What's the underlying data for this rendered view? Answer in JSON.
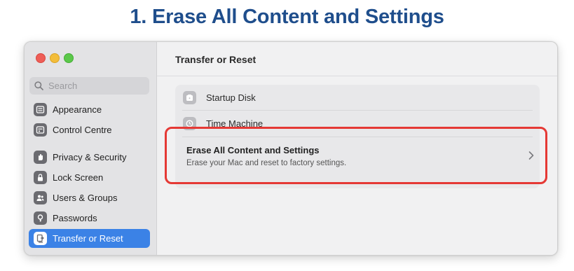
{
  "heading": "1. Erase All Content and Settings",
  "window": {
    "traffic_lights": [
      "close",
      "minimize",
      "zoom"
    ]
  },
  "sidebar": {
    "search_placeholder": "Search",
    "items": [
      {
        "label": "Appearance",
        "icon": "appearance-icon"
      },
      {
        "label": "Control Centre",
        "icon": "control-centre-icon"
      },
      {
        "label": "Privacy & Security",
        "icon": "hand-icon"
      },
      {
        "label": "Lock Screen",
        "icon": "lock-icon"
      },
      {
        "label": "Users & Groups",
        "icon": "users-icon"
      },
      {
        "label": "Passwords",
        "icon": "key-icon"
      },
      {
        "label": "Transfer or Reset",
        "icon": "transfer-reset-icon",
        "active": true
      }
    ]
  },
  "main": {
    "title": "Transfer or Reset",
    "rows": [
      {
        "label": "Startup Disk",
        "icon": "disk-icon"
      },
      {
        "label": "Time Machine",
        "icon": "time-machine-icon"
      }
    ],
    "erase": {
      "title": "Erase All Content and Settings",
      "subtitle": "Erase your Mac and reset to factory settings.",
      "icon": "chevron-right-icon"
    }
  },
  "colors": {
    "heading": "#1f4e8c",
    "accent": "#3b82e6",
    "highlight": "#e53935"
  }
}
